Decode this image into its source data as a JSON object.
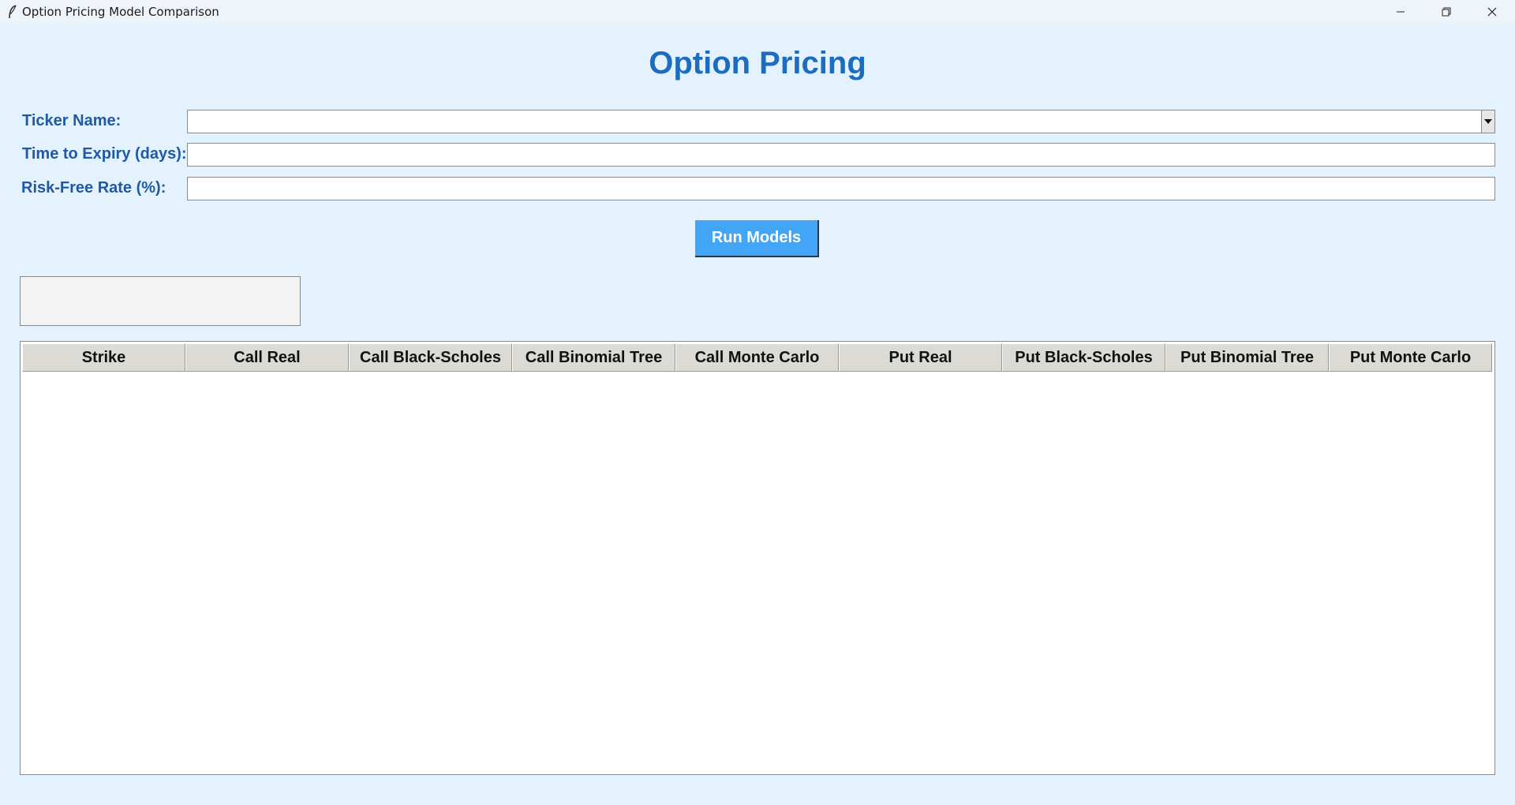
{
  "window": {
    "title": "Option Pricing Model Comparison",
    "icons": [
      "feather-app-icon",
      "minimize-icon",
      "restore-icon",
      "close-icon"
    ]
  },
  "header": {
    "title": "Option Pricing"
  },
  "form": {
    "ticker": {
      "label": "Ticker Name:",
      "value": ""
    },
    "expiry": {
      "label": "Time to Expiry (days):",
      "value": ""
    },
    "rate": {
      "label": "Risk-Free Rate (%):",
      "value": ""
    }
  },
  "actions": {
    "run_label": "Run Models"
  },
  "status": {
    "text": ""
  },
  "table": {
    "columns": [
      "Strike",
      "Call Real",
      "Call Black-Scholes",
      "Call Binomial Tree",
      "Call Monte Carlo",
      "Put Real",
      "Put Black-Scholes",
      "Put Binomial Tree",
      "Put Monte Carlo"
    ],
    "rows": []
  },
  "colors": {
    "background": "#e3f2fd",
    "heading": "#1e6cc0",
    "label": "#1f5aa6",
    "button": "#42a5f5",
    "header_cell": "#dcdad5"
  }
}
